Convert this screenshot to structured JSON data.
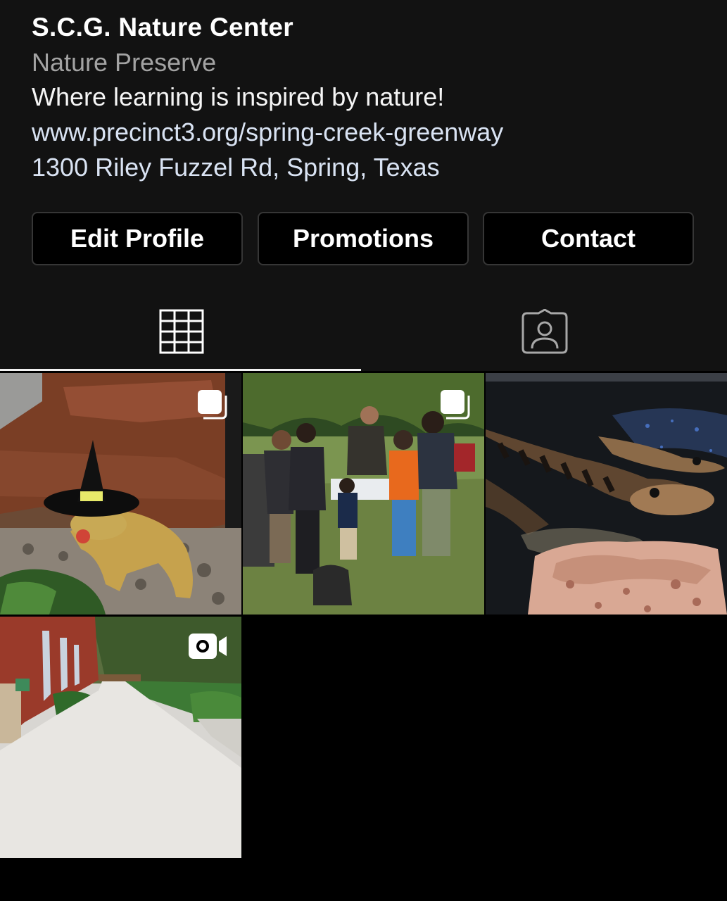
{
  "profile": {
    "name": "S.C.G. Nature Center",
    "category": "Nature Preserve",
    "bio": "Where learning is inspired by nature!",
    "website": "www.precinct3.org/spring-creek-greenway",
    "address": "1300 Riley Fuzzel Rd, Spring, Texas"
  },
  "actions": {
    "edit_profile": "Edit Profile",
    "promotions": "Promotions",
    "contact": "Contact"
  },
  "tabs": [
    {
      "icon": "grid-icon",
      "active": true
    },
    {
      "icon": "tagged-icon",
      "active": false
    }
  ],
  "posts": [
    {
      "subject": "bearded dragon in witch hat",
      "type_icon": "carousel-icon"
    },
    {
      "subject": "family activity outdoors",
      "type_icon": "carousel-icon"
    },
    {
      "subject": "baby alligators",
      "type_icon": ""
    },
    {
      "subject": "sidewalk beside building",
      "type_icon": "video-icon"
    }
  ],
  "colors": {
    "profile_bg": "#121212",
    "page_bg": "#000000",
    "secondary_text": "#a3a3a3",
    "link_text": "#d9e3f3",
    "button_border": "#363636"
  }
}
